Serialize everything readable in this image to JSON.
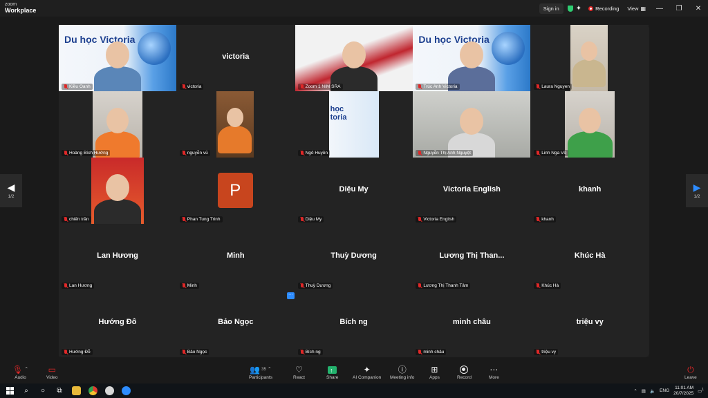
{
  "window": {
    "brand_top": "zoom",
    "brand_bottom": "Workplace",
    "sign_in": "Sign in",
    "recording": "Recording",
    "view": "View",
    "minimize": "—",
    "restore": "❐",
    "close": "✕"
  },
  "tiles": [
    {
      "label": "Kiều Oanh",
      "center": "",
      "video": "poster-person"
    },
    {
      "label": "victoria",
      "center": "victoria",
      "video": "none"
    },
    {
      "label": "Zoom 1 NIM SRA",
      "center": "",
      "video": "speaker",
      "active": true
    },
    {
      "label": "Trúc Anh Victoria",
      "center": "",
      "video": "poster-person2"
    },
    {
      "label": "Laura Nguyen",
      "center": "",
      "video": "narrow-woman"
    },
    {
      "label": "Hoàng Bích Hường",
      "center": "",
      "video": "girl"
    },
    {
      "label": "nguyễn vũ",
      "center": "",
      "video": "boy-door"
    },
    {
      "label": "Ngô Huyền",
      "center": "",
      "video": "plane"
    },
    {
      "label": "Nguyễn Thị Anh Nguyệt",
      "center": "",
      "video": "room-kid"
    },
    {
      "label": "Linh Nga Võ",
      "center": "",
      "video": "green-woman"
    },
    {
      "label": "chiến trần",
      "center": "",
      "video": "red-room"
    },
    {
      "label": "Phan Tung Trinh",
      "center": "",
      "video": "avatar",
      "avatar": "P"
    },
    {
      "label": "Diệu My",
      "center": "Diệu My",
      "video": "none"
    },
    {
      "label": "Victoria English",
      "center": "Victoria English",
      "video": "none"
    },
    {
      "label": "khanh",
      "center": "khanh",
      "video": "none"
    },
    {
      "label": "Lan Hương",
      "center": "Lan Hương",
      "video": "none"
    },
    {
      "label": "Minh",
      "center": "Minh",
      "video": "none"
    },
    {
      "label": "Thuỳ Dương",
      "center": "Thuỳ Dương",
      "video": "none"
    },
    {
      "label": "Lương Thị Thanh Tâm",
      "center": "Lương Thị Than...",
      "video": "none"
    },
    {
      "label": "Khúc Hà",
      "center": "Khúc Hà",
      "video": "none"
    },
    {
      "label": "Hướng Đỗ",
      "center": "Hướng Đỗ",
      "video": "none"
    },
    {
      "label": "Bảo Ngọc",
      "center": "Bảo Ngọc",
      "video": "none"
    },
    {
      "label": "Bích ng",
      "center": "Bích ng",
      "video": "none"
    },
    {
      "label": "minh châu",
      "center": "minh châu",
      "video": "none"
    },
    {
      "label": "triệu vy",
      "center": "triệu vy",
      "video": "none"
    }
  ],
  "poster_text": "Du học Victoria",
  "poster_text_short": "học toria",
  "paging": {
    "left": "1/2",
    "right": "1/2",
    "more_dots": "···"
  },
  "toolbar": {
    "audio": "Audio",
    "video": "Video",
    "participants": "Participants",
    "participants_count": "35",
    "react": "React",
    "share": "Share",
    "ai_companion": "AI Companion",
    "meeting_info": "Meeting info",
    "apps": "Apps",
    "record": "Record",
    "more": "More",
    "leave": "Leave"
  },
  "taskbar": {
    "time": "11:01 AM",
    "date": "20/7/2025",
    "lang": "ENG",
    "notif_count": "1"
  }
}
